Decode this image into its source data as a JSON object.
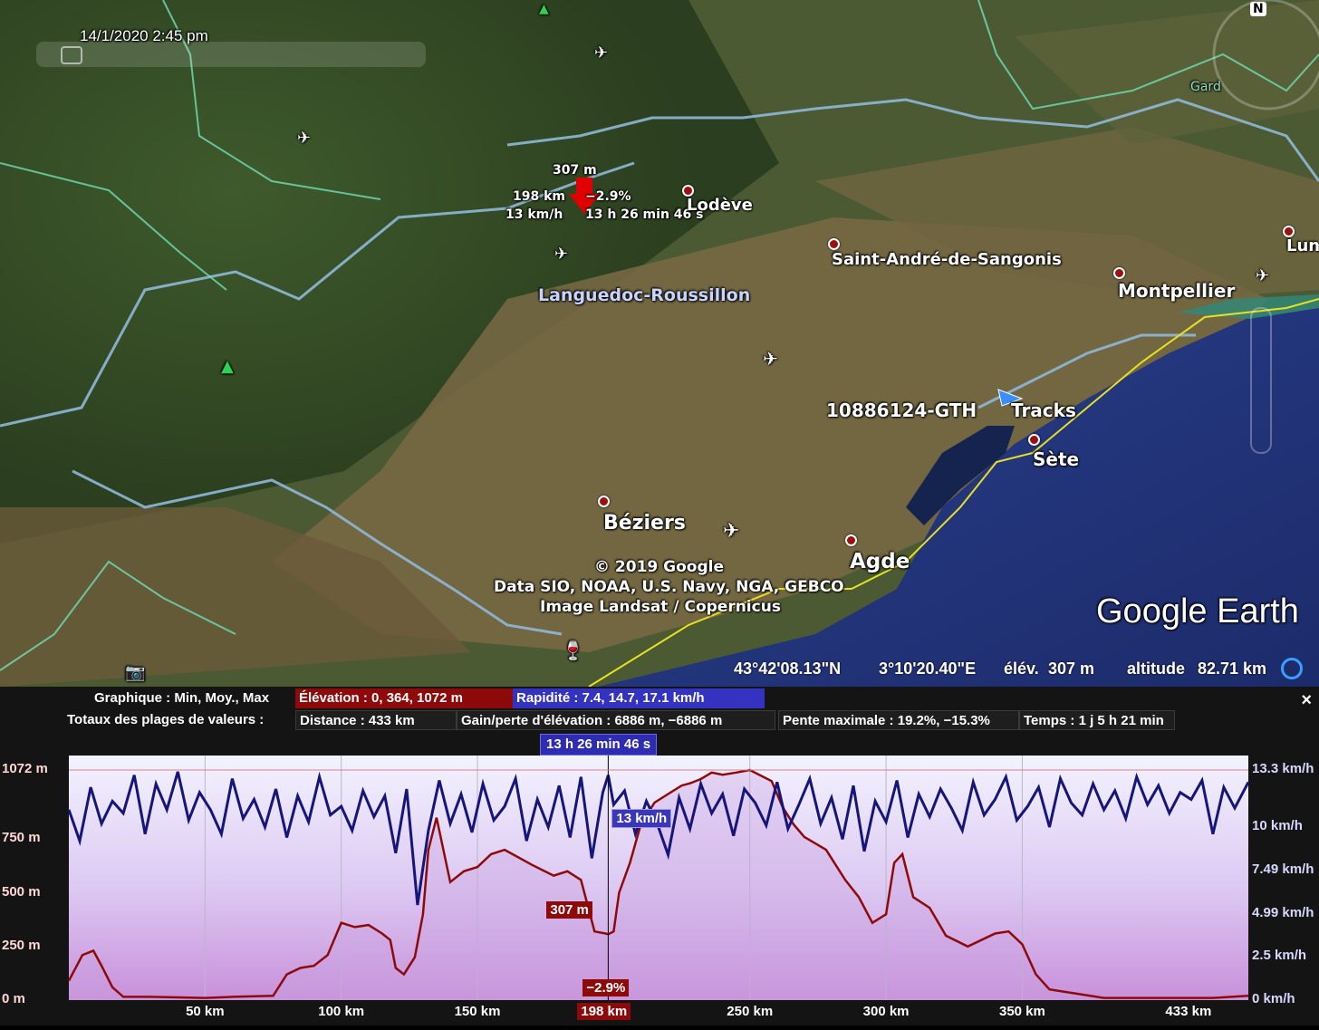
{
  "map": {
    "datetime": "14/1/2020  2:45 pm",
    "compass_letter": "N",
    "cursor_info": {
      "elevation": "307 m",
      "distance": "198 km",
      "slope": "−2.9%",
      "speed": "13 km/h",
      "elapsed": "13 h 26 min 46 s"
    },
    "places": {
      "lodeve": "Lodève",
      "saint_andre": "Saint-André-de-Sangonis",
      "montpellier": "Montpellier",
      "lunel": "Lun",
      "region": "Languedoc-Roussillon",
      "track_id": "10886124-GTH",
      "tracks": "Tracks",
      "sete": "Sète",
      "beziers": "Béziers",
      "agde": "Agde",
      "gard": "Gard"
    },
    "attribution": [
      "© 2019 Google",
      "Data SIO, NOAA, U.S. Navy, NGA, GEBCO",
      "Image Landsat / Copernicus"
    ],
    "brand": "Google Earth"
  },
  "status": {
    "lat": "43°42'08.13\"N",
    "lon": "3°10'20.40\"E",
    "elev_label": "élév.",
    "elev_value": "307 m",
    "alt_label": "altitude",
    "alt_value": "82.71 km"
  },
  "panel": {
    "graph_label": "Graphique : Min, Moy., Max",
    "elevation_stat": "Élévation : 0, 364, 1072 m",
    "speed_stat": "Rapidité : 7.4, 14.7, 17.1 km/h",
    "totals_label": "Totaux des plages de valeurs :",
    "distance": "Distance : 433 km",
    "gain": "Gain/perte d'élévation : 6886 m, −6886 m",
    "slope_max": "Pente maximale : 19.2%, −15.3%",
    "time": "Temps : 1 j 5 h 21 min",
    "close": "×",
    "time_badge": "13 h 26 min 46 s",
    "colors": {
      "elevation": "#8e0a0a",
      "speed": "#15157a",
      "accent_blue": "#3432c0"
    }
  },
  "chart_data": {
    "type": "line",
    "x_unit": "km",
    "x_range": [
      0,
      433
    ],
    "y_left": {
      "unit": "m",
      "range": [
        0,
        1072
      ],
      "ticks": [
        "1072 m",
        "750 m",
        "500 m",
        "250 m",
        "0 m"
      ]
    },
    "y_right": {
      "unit": "km/h",
      "range": [
        0,
        13.3
      ],
      "ticks": [
        "13.3 km/h",
        "10 km/h",
        "7.49 km/h",
        "4.99 km/h",
        "2.5 km/h",
        "0 km/h"
      ]
    },
    "x_ticks": [
      "50 km",
      "100 km",
      "150 km",
      "250 km",
      "300 km",
      "350 km",
      "433 km"
    ],
    "cursor_x_label": "198 km",
    "cursor_x": 198,
    "cursor_elev_label": "307 m",
    "cursor_speed_label": "13 km/h",
    "cursor_slope_label": "−2.9%",
    "series": [
      {
        "name": "Élévation",
        "x": [
          0,
          5,
          9,
          12,
          16,
          20,
          30,
          50,
          60,
          75,
          80,
          85,
          90,
          95,
          100,
          105,
          110,
          115,
          118,
          120,
          123,
          127,
          130,
          132,
          135,
          140,
          145,
          150,
          155,
          160,
          170,
          178,
          183,
          188,
          193,
          197,
          198,
          200,
          202,
          206,
          210,
          215,
          220,
          225,
          228,
          232,
          236,
          240,
          245,
          250,
          258,
          262,
          266,
          270,
          278,
          285,
          290,
          295,
          300,
          303,
          306,
          310,
          316,
          322,
          330,
          340,
          345,
          350,
          355,
          360,
          380,
          400,
          420,
          433
        ],
        "y": [
          90,
          210,
          230,
          160,
          60,
          15,
          15,
          10,
          15,
          20,
          120,
          150,
          160,
          210,
          360,
          340,
          350,
          310,
          280,
          150,
          120,
          200,
          400,
          700,
          850,
          550,
          600,
          620,
          680,
          700,
          630,
          580,
          600,
          560,
          320,
          310,
          307,
          320,
          500,
          640,
          820,
          920,
          960,
          1000,
          1010,
          1030,
          1060,
          1050,
          1060,
          1072,
          1020,
          900,
          820,
          760,
          700,
          560,
          480,
          360,
          400,
          640,
          680,
          480,
          430,
          300,
          250,
          310,
          320,
          260,
          120,
          50,
          10,
          10,
          10,
          20
        ]
      },
      {
        "name": "Rapidité",
        "x": [
          0,
          4,
          8,
          12,
          16,
          20,
          24,
          28,
          32,
          36,
          40,
          44,
          48,
          52,
          56,
          60,
          64,
          68,
          72,
          76,
          80,
          84,
          88,
          92,
          96,
          100,
          104,
          108,
          112,
          116,
          120,
          124,
          128,
          132,
          136,
          140,
          144,
          148,
          152,
          156,
          160,
          164,
          168,
          172,
          176,
          180,
          184,
          188,
          192,
          196,
          198,
          200,
          204,
          208,
          212,
          216,
          220,
          224,
          228,
          232,
          236,
          240,
          244,
          248,
          252,
          256,
          260,
          264,
          268,
          272,
          276,
          280,
          284,
          288,
          292,
          296,
          300,
          304,
          308,
          312,
          316,
          320,
          324,
          328,
          332,
          336,
          340,
          344,
          348,
          352,
          356,
          360,
          364,
          368,
          372,
          376,
          380,
          384,
          388,
          392,
          396,
          400,
          404,
          408,
          412,
          416,
          420,
          424,
          428,
          433
        ],
        "y": [
          11,
          9.2,
          12.3,
          10.2,
          11.5,
          10.8,
          13,
          9.6,
          12.5,
          11,
          13.2,
          10.4,
          12,
          11,
          9.6,
          12.8,
          10.5,
          11.6,
          10,
          12.2,
          9.4,
          11.8,
          10.3,
          12.9,
          10.7,
          11.2,
          9.8,
          12.1,
          10.6,
          11.8,
          8.5,
          12.2,
          5.5,
          9.8,
          12.7,
          10.2,
          11.9,
          9.7,
          12.5,
          10.4,
          11.2,
          12.8,
          9.2,
          11.6,
          10,
          12.4,
          9.4,
          12.9,
          8.2,
          12,
          13,
          11.3,
          12.1,
          9.6,
          11.5,
          10.2,
          8.4,
          11.7,
          9.9,
          12.5,
          10.8,
          11.9,
          9.5,
          12.2,
          11.4,
          10.1,
          12.6,
          9.9,
          11.3,
          12.8,
          10.2,
          11.7,
          9.3,
          12.4,
          8.6,
          11.5,
          10.3,
          12.7,
          9.4,
          11.9,
          10.6,
          12.2,
          11.1,
          9.8,
          12.6,
          10.7,
          11.6,
          12.9,
          10.4,
          11.2,
          12.3,
          10,
          12.8,
          11.4,
          10.7,
          12.5,
          11,
          12.1,
          10.5,
          12.9,
          11.3,
          12.4,
          10.8,
          12,
          11.6,
          12.7,
          9.6,
          12.3,
          11.1,
          12.6
        ]
      }
    ]
  }
}
